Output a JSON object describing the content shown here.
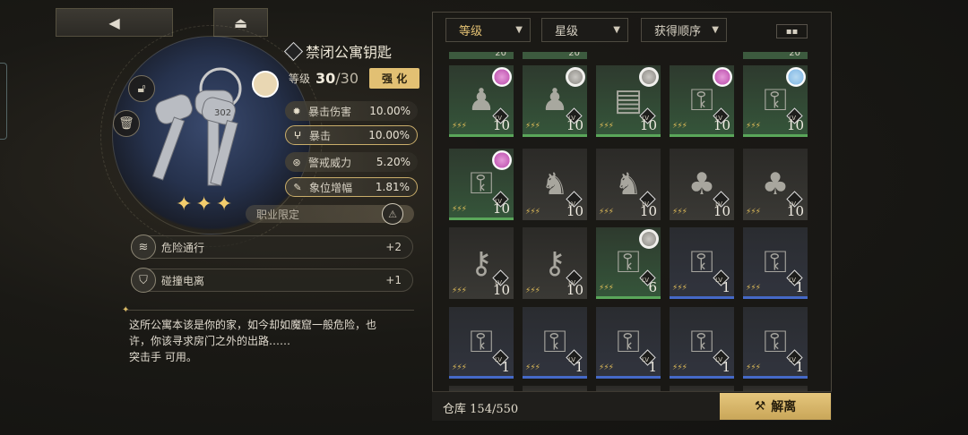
{
  "top": {
    "back_icon": "back-arrow-icon",
    "home_icon": "eject-icon"
  },
  "item": {
    "name": "禁闭公寓钥匙",
    "level_label": "等级",
    "level_current": "30",
    "level_max": "/30",
    "enhance_label": "强 化",
    "stats": [
      {
        "label": "暴击伤害",
        "value": "10.00%",
        "highlight": false
      },
      {
        "label": "暴击",
        "value": "10.00%",
        "highlight": true
      },
      {
        "label": "警戒威力",
        "value": "5.20%",
        "highlight": false
      },
      {
        "label": "象位增幅",
        "value": "1.81%",
        "highlight": true
      }
    ],
    "class_limit": "职业限定",
    "skills": [
      {
        "name": "危险通行",
        "value": "+2"
      },
      {
        "name": "碰撞电离",
        "value": "+1"
      }
    ],
    "description_lines": [
      "这所公寓本该是你的家，如今却如魔窟一般危险，也",
      "许，你该寻求房门之外的出路……",
      "突击手 可用。"
    ]
  },
  "filters": {
    "level": "等级",
    "stars": "星级",
    "order": "获得顺序"
  },
  "top_strip_values": [
    "20",
    "20",
    "20"
  ],
  "inventory": [
    {
      "style": "green",
      "art": "♟",
      "level": "10",
      "avatar": "pink"
    },
    {
      "style": "green",
      "art": "♟",
      "level": "10",
      "avatar": "white"
    },
    {
      "style": "green",
      "art": "▤",
      "level": "10",
      "avatar": "white"
    },
    {
      "style": "green",
      "art": "⚿",
      "level": "10",
      "avatar": "pink"
    },
    {
      "style": "green",
      "art": "⚿",
      "level": "10",
      "avatar": "lblue"
    },
    {
      "style": "green",
      "art": "⚿",
      "level": "10",
      "avatar": "pink"
    },
    {
      "style": "gray",
      "art": "♞",
      "level": "10",
      "avatar": ""
    },
    {
      "style": "gray",
      "art": "♞",
      "level": "10",
      "avatar": ""
    },
    {
      "style": "gray",
      "art": "♣",
      "level": "10",
      "avatar": ""
    },
    {
      "style": "gray",
      "art": "♣",
      "level": "10",
      "avatar": ""
    },
    {
      "style": "gray",
      "art": "⚷",
      "level": "10",
      "avatar": ""
    },
    {
      "style": "gray",
      "art": "⚷",
      "level": "10",
      "avatar": ""
    },
    {
      "style": "green",
      "art": "⚿",
      "level": "6",
      "avatar": "white"
    },
    {
      "style": "blue",
      "art": "⚿",
      "level": "1",
      "avatar": ""
    },
    {
      "style": "blue",
      "art": "⚿",
      "level": "1",
      "avatar": ""
    },
    {
      "style": "blue",
      "art": "⚿",
      "level": "1",
      "avatar": ""
    },
    {
      "style": "blue",
      "art": "⚿",
      "level": "1",
      "avatar": ""
    },
    {
      "style": "blue",
      "art": "⚿",
      "level": "1",
      "avatar": ""
    },
    {
      "style": "blue",
      "art": "⚿",
      "level": "1",
      "avatar": ""
    },
    {
      "style": "blue",
      "art": "⚿",
      "level": "1",
      "avatar": ""
    }
  ],
  "footer": {
    "storage_label": "仓库",
    "storage_value": "154/550",
    "dismantle_label": "解离"
  },
  "colors": {
    "accent_gold": "#e2c073",
    "rarity_blue": "#4569c7",
    "rarity_green": "#35553a"
  }
}
